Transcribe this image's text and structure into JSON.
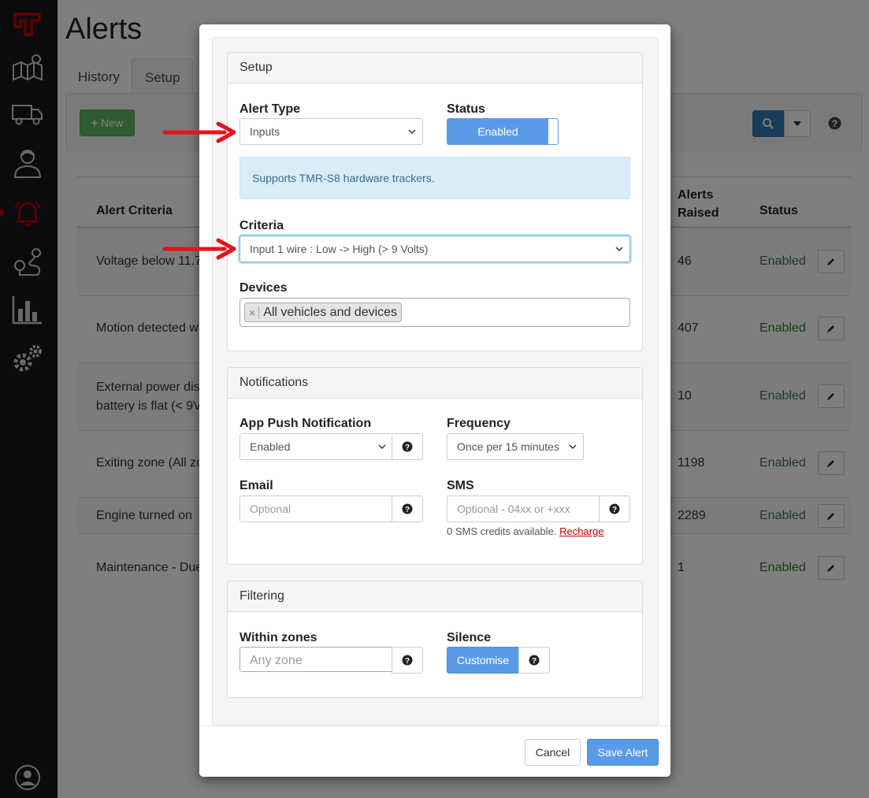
{
  "page": {
    "title": "Alerts",
    "tabs": [
      "History",
      "Setup"
    ],
    "new_button": "New"
  },
  "table": {
    "headers": {
      "criteria": "Alert Criteria",
      "raised_line1": "Alerts",
      "raised_line2": "Raised",
      "status": "Status"
    },
    "rows": [
      {
        "criteria": "Voltage below 11.7",
        "raised": "46",
        "status": "Enabled"
      },
      {
        "criteria": "Motion detected w",
        "raised": "407",
        "status": "Enabled"
      },
      {
        "criteria_line1": "External power dis",
        "criteria_line2": "battery is flat (< 9V",
        "raised": "10",
        "status": "Enabled"
      },
      {
        "criteria": "Exiting zone (All zo",
        "raised": "1198",
        "status": "Enabled"
      },
      {
        "criteria": "Engine turned on",
        "raised": "2289",
        "status": "Enabled"
      },
      {
        "criteria": "Maintenance - Due",
        "raised": "1",
        "status": "Enabled"
      }
    ]
  },
  "modal": {
    "setup": {
      "heading": "Setup",
      "alert_type_label": "Alert Type",
      "alert_type_value": "Inputs",
      "status_label": "Status",
      "status_value": "Enabled",
      "info_text": "Supports TMR-S8 hardware trackers.",
      "criteria_label": "Criteria",
      "criteria_value": "Input 1 wire : Low -> High (> 9 Volts)",
      "devices_label": "Devices",
      "devices_tag": "All vehicles and devices"
    },
    "notifications": {
      "heading": "Notifications",
      "push_label": "App Push Notification",
      "push_value": "Enabled",
      "frequency_label": "Frequency",
      "frequency_value": "Once per 15 minutes",
      "email_label": "Email",
      "email_placeholder": "Optional",
      "sms_label": "SMS",
      "sms_placeholder": "Optional - 04xx or +xxx",
      "sms_note": "0 SMS credits available.",
      "recharge_link": "Recharge"
    },
    "filtering": {
      "heading": "Filtering",
      "zones_label": "Within zones",
      "zones_placeholder": "Any zone",
      "silence_label": "Silence",
      "customise_button": "Customise"
    },
    "footer": {
      "cancel": "Cancel",
      "save": "Save Alert"
    }
  },
  "colors": {
    "sidebar": "#17171d",
    "brand_red": "#c40000",
    "primary_blue": "#5a9be8",
    "success_green": "#5cb85c",
    "status_green": "#3c763d",
    "arrow_red": "#e8121b"
  },
  "icons": [
    "brand-logo-icon",
    "map-icon",
    "truck-icon",
    "driver-icon",
    "bell-icon",
    "route-icon",
    "chart-icon",
    "gears-icon",
    "user-account-icon",
    "search-icon",
    "help-icon",
    "pencil-icon",
    "chevron-down-icon"
  ]
}
